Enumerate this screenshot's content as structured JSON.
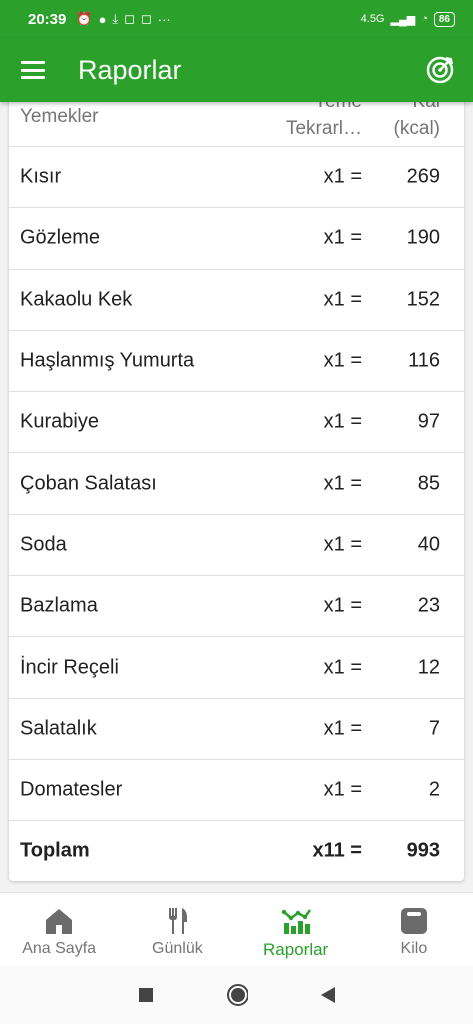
{
  "status_bar": {
    "time": "20:39",
    "battery": "86",
    "network": "4.5G"
  },
  "app_bar": {
    "title": "Raporlar"
  },
  "table": {
    "headers": {
      "food": "Yemekler",
      "repeat_line1": "Yeme",
      "repeat_line2": "Tekrarl…",
      "kcal_line1": "Kal",
      "kcal_line2": "(kcal)"
    },
    "rows": [
      {
        "name": "Kısır",
        "repeat": "x1 =",
        "kcal": "269"
      },
      {
        "name": "Gözleme",
        "repeat": "x1 =",
        "kcal": "190"
      },
      {
        "name": "Kakaolu Kek",
        "repeat": "x1 =",
        "kcal": "152"
      },
      {
        "name": "Haşlanmış Yumurta",
        "repeat": "x1 =",
        "kcal": "116"
      },
      {
        "name": "Kurabiye",
        "repeat": "x1 =",
        "kcal": "97"
      },
      {
        "name": "Çoban Salatası",
        "repeat": "x1 =",
        "kcal": "85"
      },
      {
        "name": "Soda",
        "repeat": "x1 =",
        "kcal": "40"
      },
      {
        "name": "Bazlama",
        "repeat": "x1 =",
        "kcal": "23"
      },
      {
        "name": "İncir Reçeli",
        "repeat": "x1 =",
        "kcal": "12"
      },
      {
        "name": "Salatalık",
        "repeat": "x1 =",
        "kcal": "7"
      },
      {
        "name": "Domatesler",
        "repeat": "x1 =",
        "kcal": "2"
      }
    ],
    "total": {
      "name": "Toplam",
      "repeat": "x11 =",
      "kcal": "993"
    }
  },
  "bottom_nav": {
    "home": "Ana Sayfa",
    "diary": "Günlük",
    "reports": "Raporlar",
    "weight": "Kilo"
  },
  "colors": {
    "brand": "#2ba02b"
  }
}
